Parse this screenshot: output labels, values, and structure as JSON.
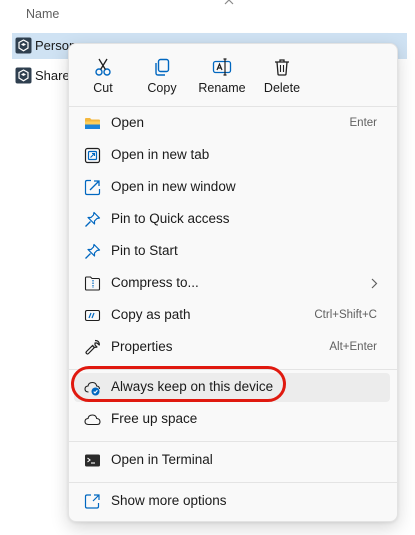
{
  "explorer": {
    "column_name": "Name",
    "files": [
      {
        "name": "Person",
        "selected": true,
        "icon": "onedrive-folder-icon"
      },
      {
        "name": "Shares",
        "selected": false,
        "icon": "onedrive-folder-icon"
      }
    ]
  },
  "quick_actions": [
    {
      "label": "Cut",
      "icon": "cut-icon"
    },
    {
      "label": "Copy",
      "icon": "copy-icon"
    },
    {
      "label": "Rename",
      "icon": "rename-icon"
    },
    {
      "label": "Delete",
      "icon": "delete-icon"
    }
  ],
  "menu": {
    "group1": [
      {
        "label": "Open",
        "shortcut": "Enter",
        "icon": "folder-icon"
      },
      {
        "label": "Open in new tab",
        "shortcut": "",
        "icon": "new-tab-icon"
      },
      {
        "label": "Open in new window",
        "shortcut": "",
        "icon": "new-window-icon"
      },
      {
        "label": "Pin to Quick access",
        "shortcut": "",
        "icon": "pin-icon"
      },
      {
        "label": "Pin to Start",
        "shortcut": "",
        "icon": "pin-icon"
      },
      {
        "label": "Compress to...",
        "shortcut": "",
        "icon": "zip-icon",
        "submenu": true
      },
      {
        "label": "Copy as path",
        "shortcut": "Ctrl+Shift+C",
        "icon": "copy-path-icon"
      },
      {
        "label": "Properties",
        "shortcut": "Alt+Enter",
        "icon": "wrench-icon"
      }
    ],
    "group2": [
      {
        "label": "Always keep on this device",
        "icon": "cloud-check-icon",
        "highlighted": true
      },
      {
        "label": "Free up space",
        "icon": "cloud-icon"
      }
    ],
    "group3": [
      {
        "label": "Open in Terminal",
        "icon": "terminal-icon"
      }
    ],
    "group4": [
      {
        "label": "Show more options",
        "icon": "share-icon"
      }
    ]
  },
  "colors": {
    "accent": "#0067c0",
    "annotation": "#e0190f",
    "selection": "#cfe2f3"
  }
}
